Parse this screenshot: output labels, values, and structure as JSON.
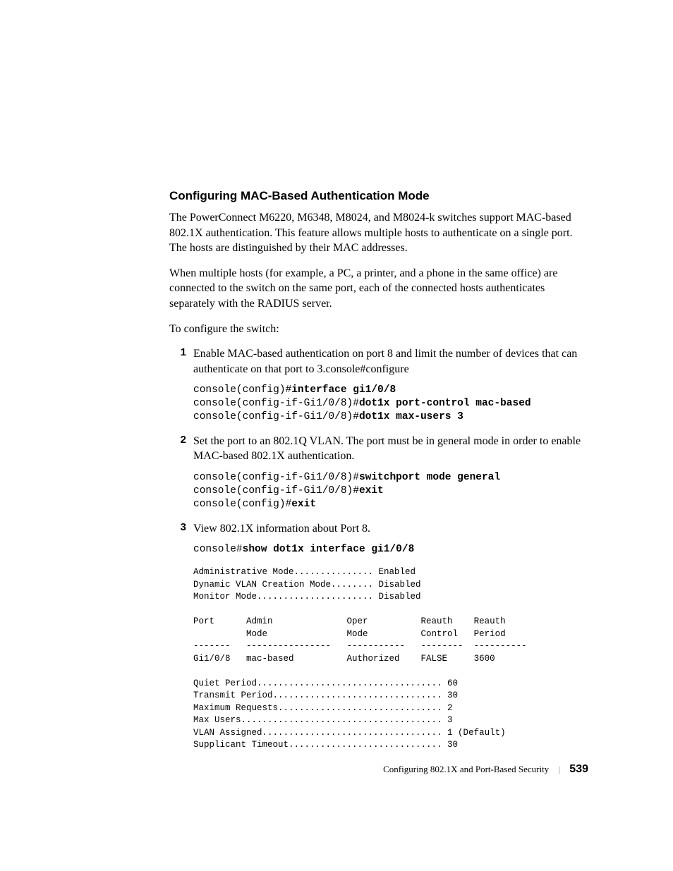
{
  "heading": "Configuring MAC-Based Authentication Mode",
  "para1": "The PowerConnect M6220, M6348, M8024, and M8024-k switches support MAC-based 802.1X authentication. This feature allows multiple hosts to authenticate on a single port. The hosts are distinguished by their MAC addresses.",
  "para2": "When multiple hosts (for example, a PC, a printer, and a phone in the same office) are connected to the switch on the same port, each of the connected hosts authenticates separately with the RADIUS server.",
  "para3": "To configure the switch:",
  "steps": {
    "s1": {
      "num": "1",
      "text": "Enable MAC-based authentication on port 8 and limit the number of devices that can authenticate on that port to 3.console#configure",
      "code_p1": "console(config)#",
      "code_b1": "interface gi1/0/8",
      "code_p2": "console(config-if-Gi1/0/8)#",
      "code_b2": "dot1x port-control mac-based",
      "code_p3": "console(config-if-Gi1/0/8)#",
      "code_b3": "dot1x max-users 3"
    },
    "s2": {
      "num": "2",
      "text": "Set the port to an 802.1Q VLAN. The port must be in general mode in order to enable MAC-based 802.1X authentication.",
      "code_p1": "console(config-if-Gi1/0/8)#",
      "code_b1": "switchport mode general",
      "code_p2": "console(config-if-Gi1/0/8)#",
      "code_b2": "exit",
      "code_p3": "console(config)#",
      "code_b3": "exit"
    },
    "s3": {
      "num": "3",
      "text": "View 802.1X information about Port 8.",
      "code_p1": "console#",
      "code_b1": "show dot1x interface gi1/0/8"
    }
  },
  "output": "Administrative Mode............... Enabled\nDynamic VLAN Creation Mode........ Disabled\nMonitor Mode...................... Disabled\n\nPort      Admin              Oper          Reauth    Reauth\n          Mode               Mode          Control   Period\n-------   ----------------   -----------   --------  ----------\nGi1/0/8   mac-based          Authorized    FALSE     3600\n\nQuiet Period................................... 60\nTransmit Period................................ 30\nMaximum Requests............................... 2\nMax Users...................................... 3\nVLAN Assigned.................................. 1 (Default)\nSupplicant Timeout............................. 30",
  "footer": {
    "title": "Configuring 802.1X and Port-Based Security",
    "page": "539"
  }
}
